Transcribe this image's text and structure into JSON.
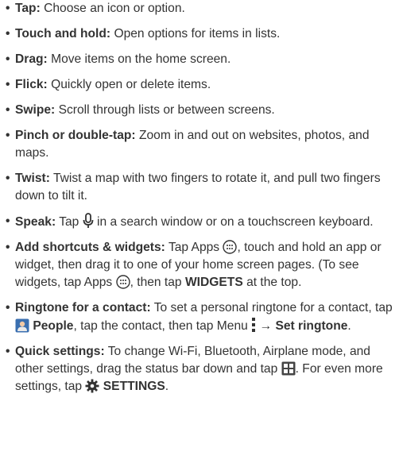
{
  "tips": [
    {
      "term": "Tap:",
      "text": "Choose an icon or option."
    },
    {
      "term": "Touch and hold:",
      "text": "Open options for items in lists."
    },
    {
      "term": "Drag:",
      "text": "Move items on the home screen."
    },
    {
      "term": "Flick:",
      "text": "Quickly open or delete items."
    },
    {
      "term": "Swipe:",
      "text": "Scroll through lists or between screens."
    },
    {
      "term": "Pinch or double-tap:",
      "text": "Zoom in and out on websites, photos, and maps."
    },
    {
      "term": "Twist:",
      "text": "Twist a map with two fingers to rotate it, and pull two fingers down to tilt it."
    },
    {
      "term": "Speak:",
      "text_1": "Tap",
      "icon": "microphone-icon",
      "text_2": "in a search window or on a touchscreen keyboard."
    },
    {
      "term": "Add shortcuts & widgets:",
      "text_1": "Tap Apps",
      "icon_1": "apps-icon",
      "text_2": ", touch and hold an app or widget, then drag it to one of your home screen pages. (To see widgets, tap Apps",
      "icon_2": "apps-icon",
      "text_3": ", then tap",
      "bold_1": "WIDGETS",
      "text_4": "at the top."
    },
    {
      "term": "Ringtone for a contact:",
      "text_1": "To set a personal ringtone for a contact, tap",
      "icon_1": "people-app-icon",
      "bold_1": "People",
      "text_2": ", tap the contact, then tap Menu",
      "icon_2": "menu-icon",
      "text_3": "→",
      "bold_2": "Set ringtone",
      "text_4": "."
    },
    {
      "term": "Quick settings:",
      "text_1": "To change Wi-Fi, Bluetooth, Airplane mode, and other settings, drag the status bar down and tap",
      "icon_1": "quick-settings-icon",
      "text_2": ". For even more settings, tap",
      "icon_2": "gear-icon",
      "bold_1": "SETTINGS",
      "text_3": "."
    }
  ],
  "colors": {
    "text": "#333333",
    "people_icon_blue": "#3a6fb0",
    "quick_settings_icon": "#444444"
  }
}
